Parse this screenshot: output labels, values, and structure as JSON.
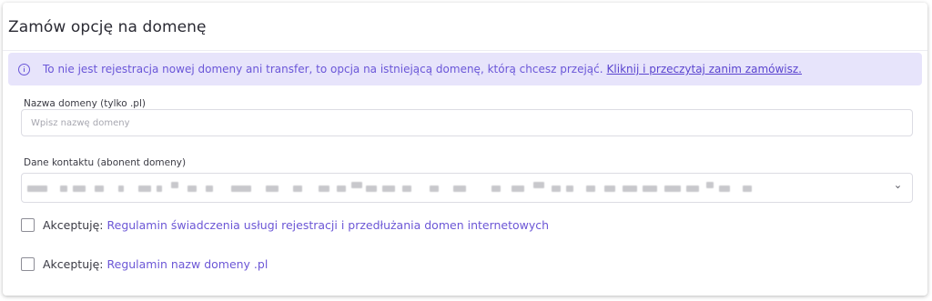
{
  "form": {
    "title": "Zamów opcję na domenę",
    "alert": {
      "text": "To nie jest rejestracja nowej domeny ani transfer, to opcja na istniejącą domenę, którą chcesz przejąć.",
      "link": "Kliknij i przeczytaj zanim zamówisz."
    },
    "domain": {
      "label": "Nazwa domeny (tylko .pl)",
      "placeholder": "Wpisz nazwę domeny",
      "value": ""
    },
    "contact": {
      "label": "Dane kontaktu (abonent domeny)"
    },
    "accept_terms": {
      "prefix": "Akceptuję:",
      "link": "Regulamin świadczenia usługi rejestracji i przedłużania domen internetowych",
      "checked": false
    },
    "accept_names": {
      "prefix": "Akceptuję:",
      "link": "Regulamin nazw domeny .pl",
      "checked": false
    }
  },
  "colors": {
    "accent": "#6a56d8",
    "alert_bg": "#e7e4fb",
    "border": "#dcdce3"
  }
}
